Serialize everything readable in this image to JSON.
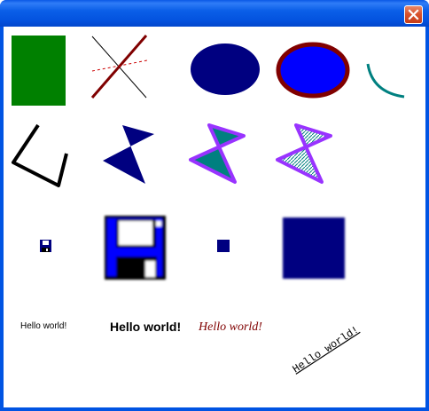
{
  "window": {
    "title": "",
    "close_icon": "close-x-icon"
  },
  "text_samples": {
    "plain": "Hello world!",
    "bold": "Hello world!",
    "serif_italic": "Hello world!",
    "rotated_mono": "Hello world!"
  },
  "colors": {
    "title_bar": "#0054e3",
    "close_button": "#d9532d",
    "green": "#008000",
    "dark_red": "#800000",
    "navy": "#000080",
    "blue": "#0000ff",
    "teal": "#008080",
    "purple_outline": "#9933ff"
  },
  "icons": [
    "floppy-disk-icon",
    "floppy-disk-icon-large",
    "blue-square-small",
    "blue-square-large-blurred"
  ]
}
